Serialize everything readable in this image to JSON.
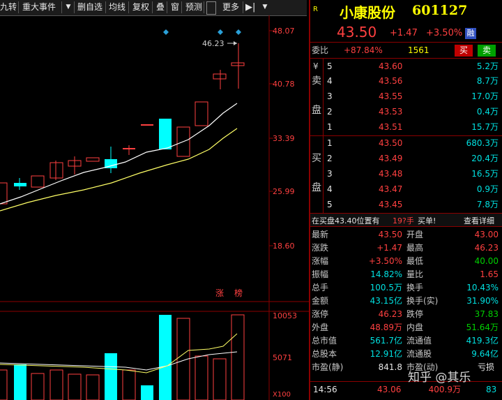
{
  "toolbar": {
    "items": [
      "九转",
      "重大事件",
      "删自选",
      "均线",
      "复权",
      "叠",
      "窗",
      "预测",
      "更多"
    ],
    "more_menu_arrow": "▼"
  },
  "price_axis": {
    "labels": [
      "48.07",
      "40.78",
      "33.39",
      "25.99",
      "18.60"
    ]
  },
  "volume_axis": {
    "labels": [
      "10053",
      "5071"
    ],
    "unit": "X100"
  },
  "chart_annot": {
    "high_label": "46.23",
    "tag1": "涨",
    "tag2": "榜"
  },
  "colors": {
    "up": "#ff4040",
    "down": "#00ffff",
    "ma_white": "#ffffff",
    "ma_yellow": "#ffff66",
    "axis": "#8b0000"
  },
  "quote": {
    "r_badge": "R",
    "name": "小康股份",
    "code": "601127",
    "price": "43.50",
    "change": "+1.47",
    "change_pct": "+3.50%",
    "margin_badge": "融"
  },
  "weibi": {
    "label": "委比",
    "pct": "+87.84%",
    "diff": "1561",
    "buy_btn": "买",
    "sell_btn": "卖"
  },
  "asks": {
    "labels": [
      "¥",
      "卖",
      "盘"
    ],
    "rows": [
      {
        "level": "5",
        "price": "43.60",
        "vol": "5.2万"
      },
      {
        "level": "4",
        "price": "43.56",
        "vol": "8.7万"
      },
      {
        "level": "3",
        "price": "43.55",
        "vol": "17.0万"
      },
      {
        "level": "2",
        "price": "43.53",
        "vol": "0.4万"
      },
      {
        "level": "1",
        "price": "43.51",
        "vol": "15.7万"
      }
    ]
  },
  "bids": {
    "labels": [
      "买",
      "盘"
    ],
    "rows": [
      {
        "level": "1",
        "price": "43.50",
        "vol": "680.3万"
      },
      {
        "level": "2",
        "price": "43.49",
        "vol": "20.4万"
      },
      {
        "level": "3",
        "price": "43.48",
        "vol": "16.5万"
      },
      {
        "level": "4",
        "price": "43.47",
        "vol": "0.9万"
      },
      {
        "level": "5",
        "price": "43.45",
        "vol": "7.8万"
      }
    ]
  },
  "notice": {
    "text1": "在买盘43.40位置有",
    "text2": "19?手",
    "text3": "买单!",
    "detail": "查看详细"
  },
  "stats": [
    {
      "k1": "最新",
      "v1": "43.50",
      "c1": "red",
      "k2": "开盘",
      "v2": "43.00",
      "c2": "red"
    },
    {
      "k1": "涨跌",
      "v1": "+1.47",
      "c1": "red",
      "k2": "最高",
      "v2": "46.23",
      "c2": "red"
    },
    {
      "k1": "涨幅",
      "v1": "+3.50%",
      "c1": "red",
      "k2": "最低",
      "v2": "40.00",
      "c2": "grn"
    },
    {
      "k1": "振幅",
      "v1": "14.82%",
      "c1": "cyan",
      "k2": "量比",
      "v2": "1.65",
      "c2": "red"
    },
    {
      "k1": "总手",
      "v1": "100.5万",
      "c1": "cyan",
      "k2": "换手",
      "v2": "10.43%",
      "c2": "cyan"
    },
    {
      "k1": "金额",
      "v1": "43.15亿",
      "c1": "cyan",
      "k2": "换手(实)",
      "v2": "31.90%",
      "c2": "cyan"
    },
    {
      "k1": "涨停",
      "v1": "46.23",
      "c1": "red",
      "k2": "跌停",
      "v2": "37.83",
      "c2": "grn"
    },
    {
      "k1": "外盘",
      "v1": "48.89万",
      "c1": "red",
      "k2": "内盘",
      "v2": "51.64万",
      "c2": "grn"
    },
    {
      "k1": "总市值",
      "v1": "561.7亿",
      "c1": "cyan",
      "k2": "流通值",
      "v2": "419.3亿",
      "c2": "cyan"
    },
    {
      "k1": "总股本",
      "v1": "12.91亿",
      "c1": "cyan",
      "k2": "流通股",
      "v2": "9.64亿",
      "c2": "cyan"
    },
    {
      "k1": "市盈(静)",
      "v1": "841.8",
      "c1": "wht",
      "k2": "市盈(动)",
      "v2": "",
      "c2": "wht",
      "extra": "亏损"
    }
  ],
  "tick": {
    "time": "14:56",
    "price": "43.06",
    "vol": "400.9万",
    "count": "83"
  },
  "watermark": "知乎 @其乐"
}
